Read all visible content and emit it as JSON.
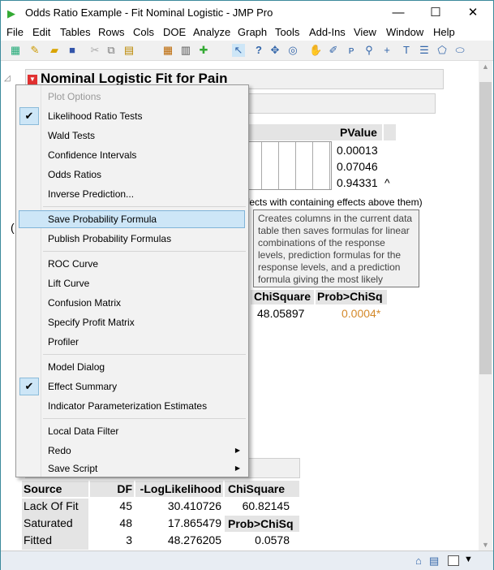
{
  "window": {
    "title": "Odds Ratio Example - Fit Nominal Logistic - JMP Pro",
    "minimize": "—",
    "maximize": "☐",
    "close": "✕"
  },
  "menubar": [
    "File",
    "Edit",
    "Tables",
    "Rows",
    "Cols",
    "DOE",
    "Analyze",
    "Graph",
    "Tools",
    "Add-Ins",
    "View",
    "Window",
    "Help"
  ],
  "report": {
    "title": "Nominal Logistic Fit for Pain",
    "effects_header": "PValue",
    "pvalues": [
      "0.00013",
      "0.07046",
      "0.94331"
    ],
    "caret": "^",
    "footnote": "fects with containing effects above them)",
    "whole_model": {
      "chisq_header": "ChiSquare",
      "prob_header": "Prob>ChiSq",
      "chisq": "48.05897",
      "prob": "0.0004*"
    },
    "lack_of_fit": {
      "headers": [
        "Source",
        "DF",
        "-LogLikelihood",
        "ChiSquare"
      ],
      "rows": [
        [
          "Lack Of Fit",
          "45",
          "30.410726",
          "60.82145"
        ],
        [
          "Saturated",
          "48",
          "17.865479",
          "Prob>ChiSq"
        ],
        [
          "Fitted",
          "3",
          "48.276205",
          "0.0578"
        ]
      ]
    }
  },
  "menu": {
    "items": [
      "Plot Options",
      "Likelihood Ratio Tests",
      "Wald Tests",
      "Confidence Intervals",
      "Odds Ratios",
      "Inverse Prediction...",
      "Save Probability Formula",
      "Publish Probability Formulas",
      "ROC Curve",
      "Lift Curve",
      "Confusion Matrix",
      "Specify Profit Matrix",
      "Profiler",
      "Model Dialog",
      "Effect Summary",
      "Indicator Parameterization Estimates",
      "Local Data Filter",
      "Redo",
      "Save Script"
    ],
    "checked": [
      "Likelihood Ratio Tests",
      "Effect Summary"
    ],
    "highlighted": "Save Probability Formula"
  },
  "tooltip": "Creates columns in the current data table then saves formulas for linear combinations of the response levels, prediction formulas for the response levels, and a prediction formula giving the most likely response.",
  "colors": {
    "accent_highlight": "#cde6f7",
    "significant": "#d4892a",
    "disclosure_red": "#e03030"
  }
}
